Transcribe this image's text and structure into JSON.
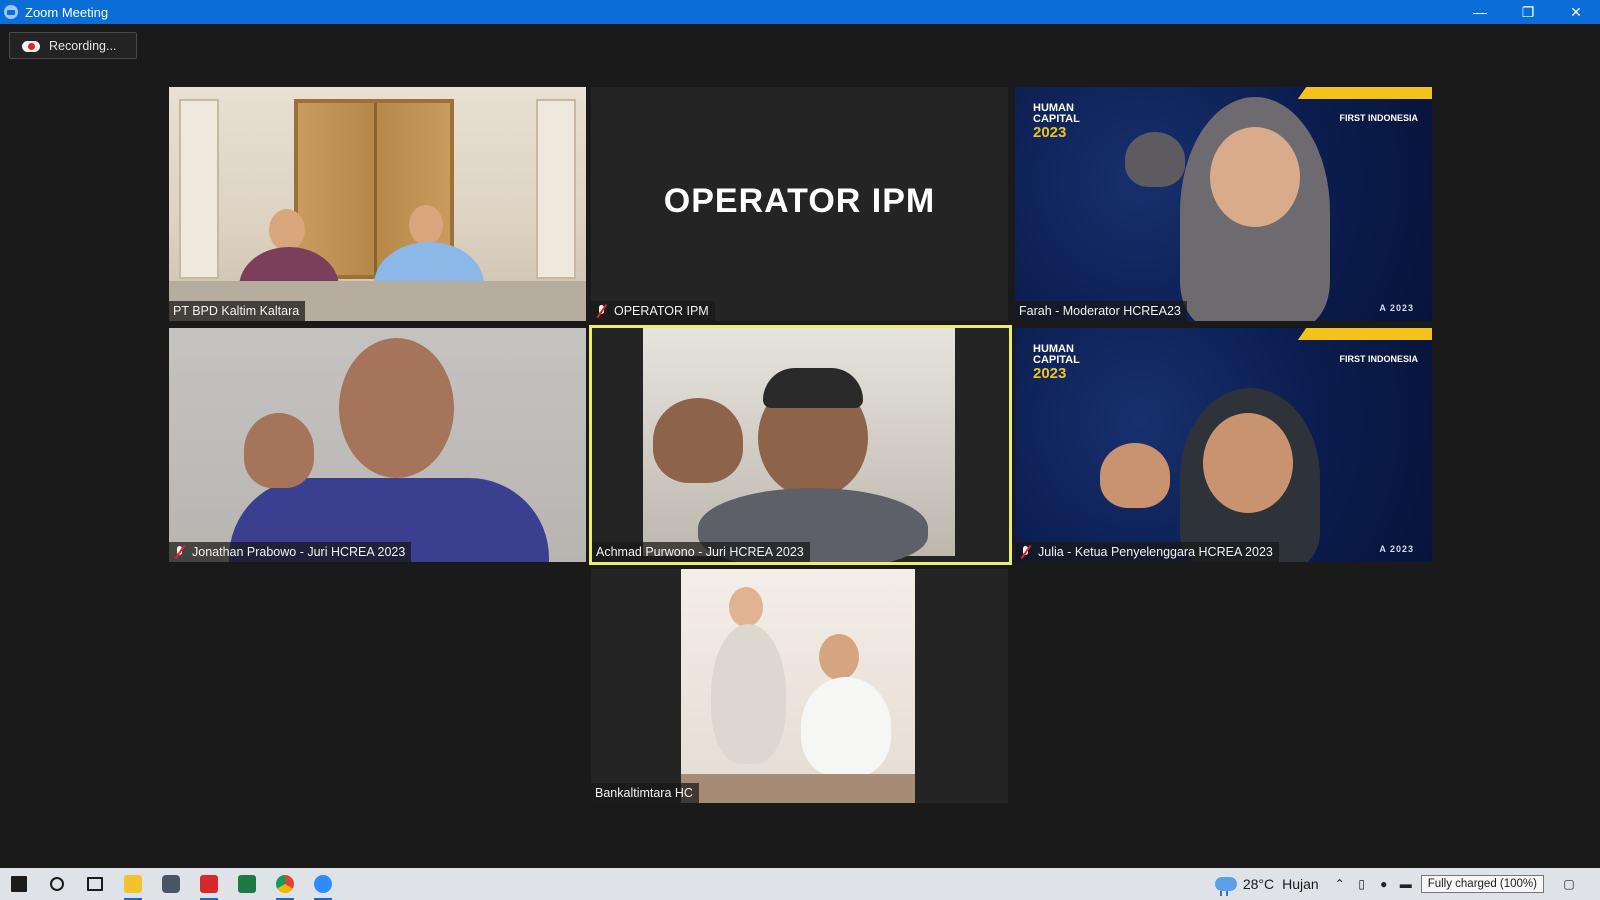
{
  "window": {
    "title": "Zoom Meeting",
    "controls": {
      "minimize": "—",
      "restore": "❐",
      "close": "✕"
    }
  },
  "recording": {
    "label": "Recording..."
  },
  "tiles": [
    {
      "name": "PT BPD Kaltim Kaltara",
      "muted": false,
      "active": false
    },
    {
      "name": "OPERATOR IPM",
      "display_name": "OPERATOR IPM",
      "muted": true,
      "active": false
    },
    {
      "name": "Farah - Moderator HCREA23",
      "muted": false,
      "active": false,
      "background_text": {
        "logo_line1": "HUMAN",
        "logo_line2": "CAPITAL",
        "logo_year": "2023",
        "corner": "FIRST INDONESIA",
        "bottom": "A 2023"
      }
    },
    {
      "name": "Jonathan Prabowo - Juri HCREA 2023",
      "muted": true,
      "active": false
    },
    {
      "name": "Achmad Purwono - Juri HCREA 2023",
      "muted": false,
      "active": true
    },
    {
      "name": "Julia - Ketua Penyelenggara HCREA 2023",
      "muted": true,
      "active": false,
      "background_text": {
        "logo_line1": "HUMAN",
        "logo_line2": "CAPITAL",
        "logo_year": "2023",
        "corner": "FIRST INDONESIA",
        "bottom": "A 2023"
      }
    },
    {
      "name": "Bankaltimtara HC",
      "muted": false,
      "active": false
    }
  ],
  "taskbar": {
    "apps": [
      "start-icon",
      "search-icon",
      "task-view-icon",
      "file-explorer-icon",
      "camera-icon",
      "wps-office-icon",
      "excel-icon",
      "chrome-icon",
      "zoom-icon"
    ],
    "weather": {
      "temperature": "28°C",
      "condition": "Hujan"
    },
    "battery_tooltip": "Fully charged (100%)"
  },
  "colors": {
    "titlebar": "#0b6ed8",
    "active_speaker": "#e9ef6a",
    "meeting_bg": "#1a1a1a"
  }
}
